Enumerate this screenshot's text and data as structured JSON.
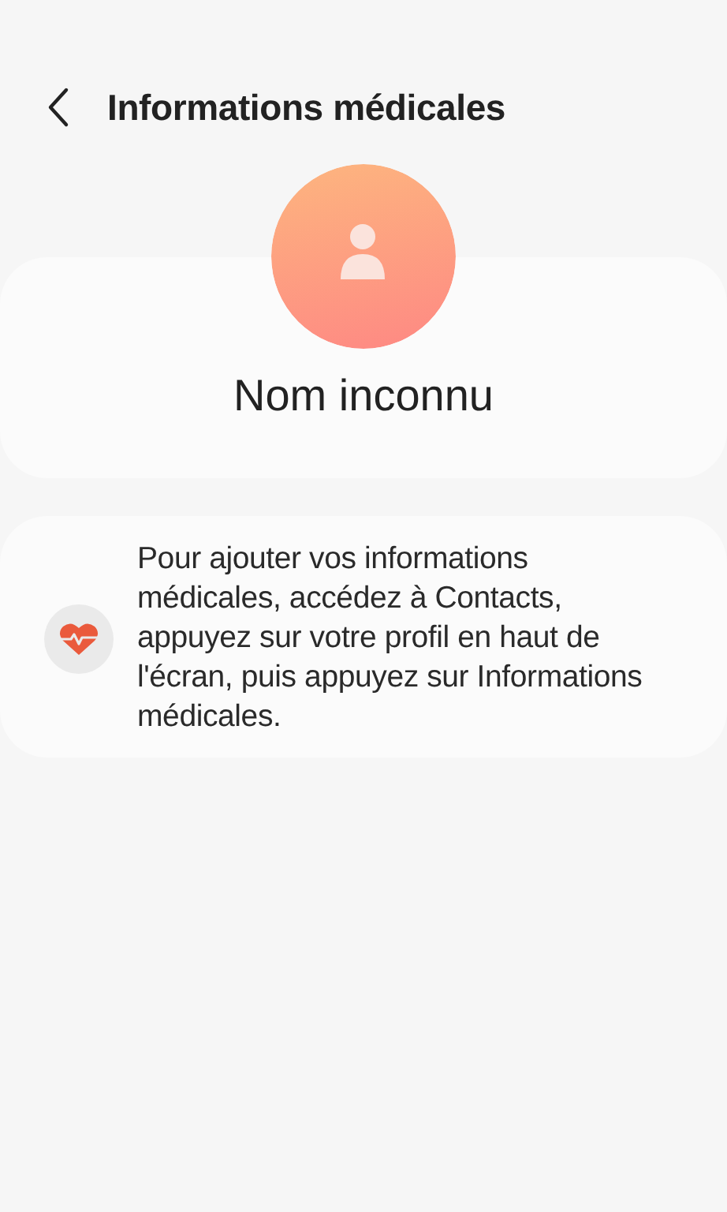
{
  "header": {
    "title": "Informations médicales"
  },
  "profile": {
    "name": "Nom inconnu"
  },
  "info": {
    "text": "Pour ajouter vos informations médicales, accédez à Contacts, appuyez sur votre profil en haut de l'écran, puis appuyez sur Informations médicales."
  }
}
